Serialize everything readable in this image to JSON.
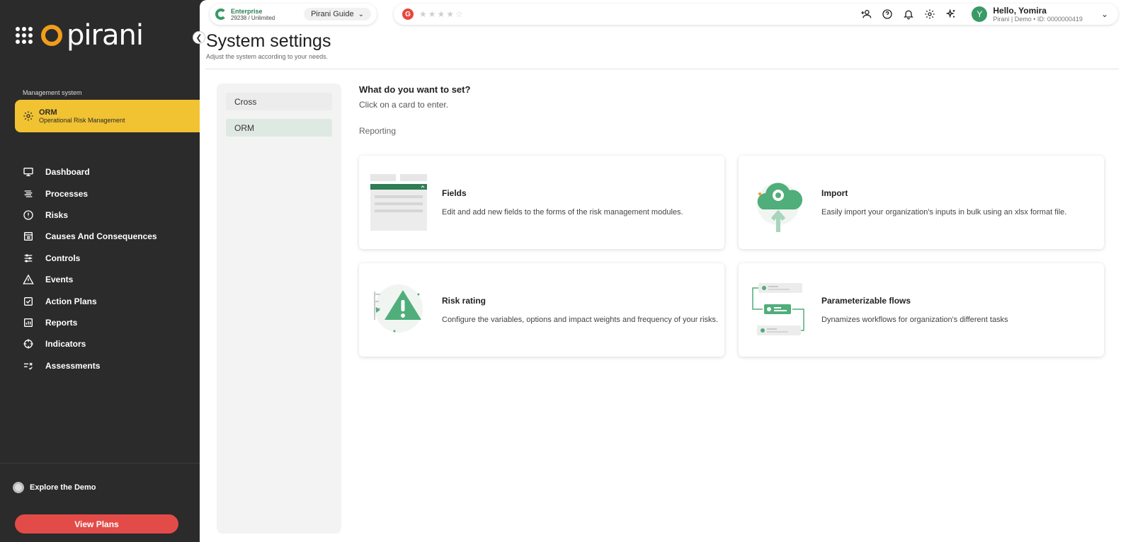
{
  "sidebar": {
    "logo_text": "pirani",
    "management_label": "Management system",
    "orm": {
      "title": "ORM",
      "subtitle": "Operational Risk Management"
    },
    "nav": [
      {
        "label": "Dashboard",
        "icon": "monitor-icon"
      },
      {
        "label": "Processes",
        "icon": "processes-icon"
      },
      {
        "label": "Risks",
        "icon": "risk-alert-icon"
      },
      {
        "label": "Causes And Consequences",
        "icon": "causes-icon"
      },
      {
        "label": "Controls",
        "icon": "sliders-icon"
      },
      {
        "label": "Events",
        "icon": "warning-triangle-icon"
      },
      {
        "label": "Action Plans",
        "icon": "checkbox-icon"
      },
      {
        "label": "Reports",
        "icon": "bar-chart-icon"
      },
      {
        "label": "Indicators",
        "icon": "crosshair-icon"
      },
      {
        "label": "Assessments",
        "icon": "assessment-list-icon"
      }
    ],
    "explore_label": "Explore the Demo",
    "view_plans_label": "View Plans"
  },
  "topbar": {
    "plan_name": "Enterprise",
    "plan_usage": "29238 / Unlimited",
    "guide_label": "Pirani Guide",
    "rating_stars": "★★★★☆",
    "greeting": "Hello, Yomira",
    "org_info": "Pirani | Demo • ID: 0000000419",
    "avatar_letter": "Y"
  },
  "page": {
    "title": "System settings",
    "subtitle": "Adjust the system according to your needs."
  },
  "left_panel": {
    "items": [
      "Cross",
      "ORM"
    ]
  },
  "content": {
    "question": "What do you want to set?",
    "hint": "Click on a card to enter.",
    "section": "Reporting",
    "cards": [
      {
        "title": "Fields",
        "description": "Edit and add new fields to the forms of the risk management modules."
      },
      {
        "title": "Import",
        "description": "Easily import your organization's inputs in bulk using an xlsx format file."
      },
      {
        "title": "Risk rating",
        "description": "Configure the variables, options and impact weights and frequency of your risks."
      },
      {
        "title": "Parameterizable flows",
        "description": "Dynamizes workflows for organization's different tasks"
      }
    ]
  },
  "colors": {
    "sidebar_bg": "#2b2b2b",
    "accent_yellow": "#f1c232",
    "brand_green": "#3a9a67",
    "view_plans_red": "#e34b48",
    "logo_orange": "#f29d1a"
  }
}
